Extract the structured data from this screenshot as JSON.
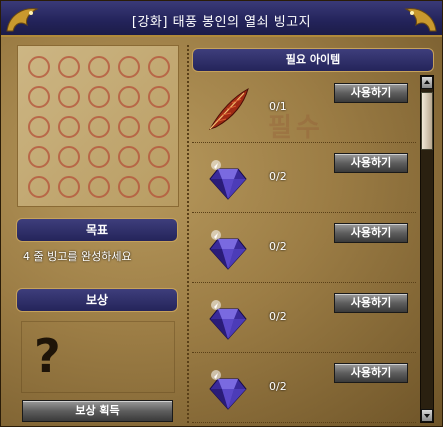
{
  "window": {
    "title": "[강화] 태풍 봉인의 열쇠 빙고지"
  },
  "left": {
    "goal_title": "목표",
    "goal_text": "4 줄 빙고를 완성하세요",
    "reward_title": "보상",
    "reward_unknown": "?",
    "claim_button": "보상 획득"
  },
  "right": {
    "required_title": "필요 아이템",
    "watermark": "필수",
    "items": [
      {
        "icon": "feather-icon",
        "count": "0/1",
        "button": "사용하기"
      },
      {
        "icon": "gem-icon",
        "count": "0/2",
        "button": "사용하기"
      },
      {
        "icon": "gem-icon",
        "count": "0/2",
        "button": "사용하기"
      },
      {
        "icon": "gem-icon",
        "count": "0/2",
        "button": "사용하기"
      },
      {
        "icon": "gem-icon",
        "count": "0/2",
        "button": "사용하기"
      }
    ]
  },
  "colors": {
    "title_bar": "#23235a",
    "accent_gold": "#c6a25a",
    "parchment": "#b89a5e",
    "bingo_circle": "#b4523a"
  }
}
